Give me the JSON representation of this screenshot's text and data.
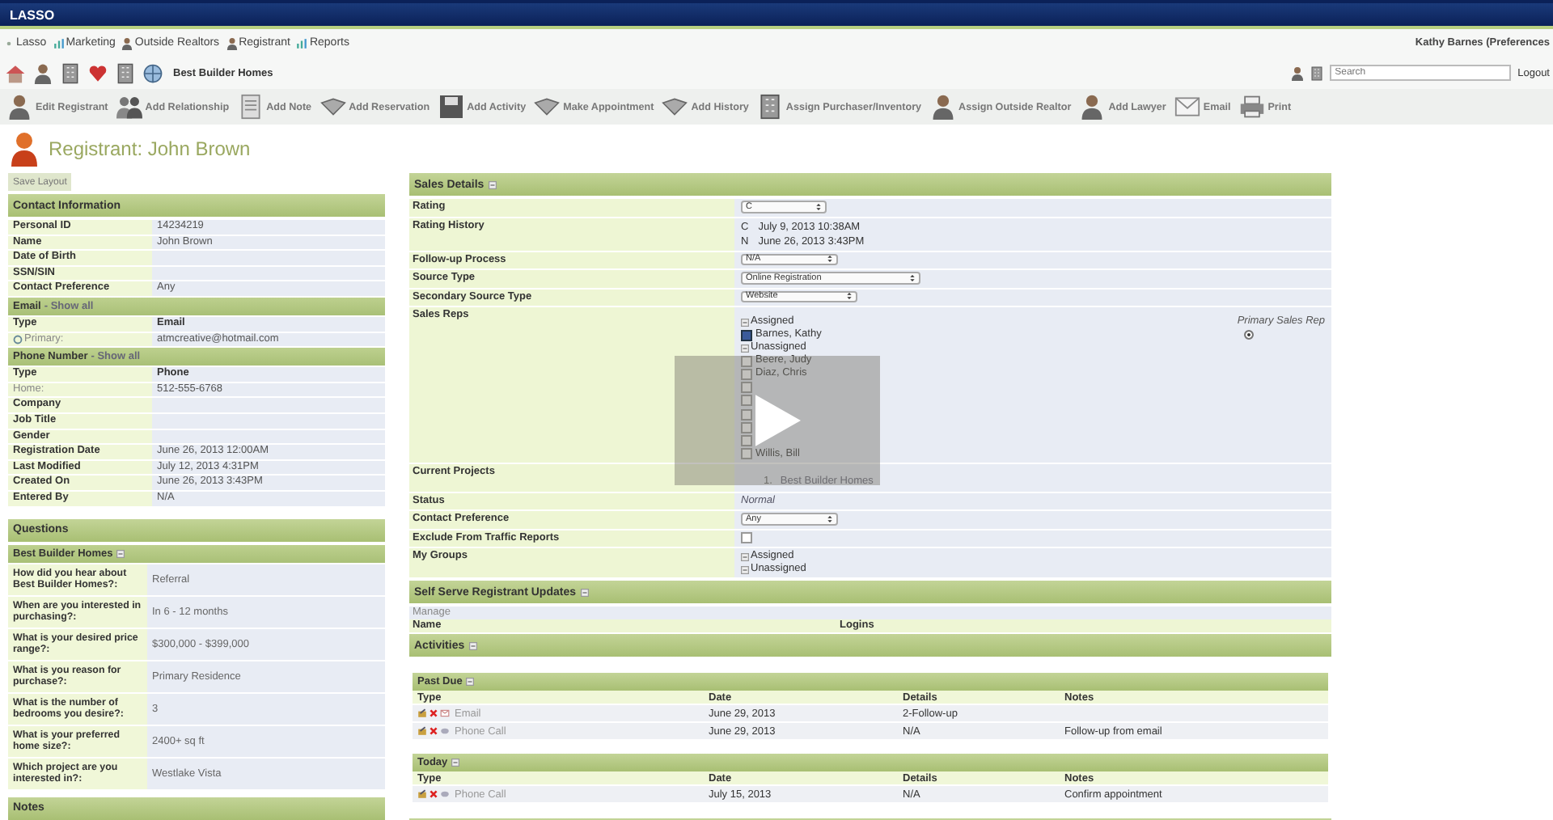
{
  "header": {
    "logo": "LASSO"
  },
  "nav": [
    "Lasso",
    "Marketing",
    "Outside Realtors",
    "Registrant",
    "Reports"
  ],
  "user": "Kathy Barnes (Preferences",
  "company": "Best Builder Homes",
  "search": {
    "placeholder": "Search"
  },
  "logout": "Logout",
  "toolbar": [
    "Edit Registrant",
    "Add Relationship",
    "Add Note",
    "Add Reservation",
    "Add Activity",
    "Make Appointment",
    "Add History",
    "Assign Purchaser/Inventory",
    "Assign Outside Realtor",
    "Add Lawyer",
    "Email",
    "Print"
  ],
  "title": "Registrant: John Brown",
  "save_layout": "Save Layout",
  "contact": {
    "title": "Contact Information",
    "fields": [
      {
        "label": "Personal ID",
        "value": "14234219"
      },
      {
        "label": "Name",
        "value": "John Brown"
      },
      {
        "label": "Date of Birth"
      },
      {
        "label": "SSN/SIN"
      },
      {
        "label": "Contact Preference",
        "value": "Any"
      }
    ],
    "email": {
      "title": "Email",
      "link": "- Show all",
      "columns": [
        "Type",
        "Email"
      ],
      "rows": [
        {
          "type": "Primary:",
          "value": "atmcreative@hotmail.com"
        }
      ]
    },
    "phone": {
      "title": "Phone Number",
      "link": "- Show all",
      "columns": [
        "Type",
        "Phone"
      ],
      "rows": [
        {
          "type": "Home:",
          "value": "512-555-6768"
        }
      ]
    },
    "more_fields": [
      {
        "label": "Company"
      },
      {
        "label": "Job Title"
      },
      {
        "label": "Gender"
      },
      {
        "label": "Registration Date",
        "value": "June 26, 2013 12:00AM"
      },
      {
        "label": "Last Modified",
        "value": "July 12, 2013 4:31PM"
      },
      {
        "label": "Created On",
        "value": "June 26, 2013 3:43PM"
      },
      {
        "label": "Entered By",
        "value": "N/A"
      }
    ]
  },
  "questions": {
    "title": "Questions",
    "subtitle": "Best Builder Homes",
    "items": [
      {
        "q": "How did you hear about Best Builder Homes?:",
        "a": "Referral"
      },
      {
        "q": "When are you interested in purchasing?:",
        "a": "In 6 - 12 months"
      },
      {
        "q": "What is your desired price range?:",
        "a": "$300,000 - $399,000"
      },
      {
        "q": "What is you reason for purchase?:",
        "a": "Primary Residence"
      },
      {
        "q": "What is the number of bedrooms you desire?:",
        "a": "3"
      },
      {
        "q": "What is your preferred home size?:",
        "a": "2400+ sq ft"
      },
      {
        "q": "Which project are you interested in?:",
        "a": "Westlake Vista"
      }
    ]
  },
  "notes": {
    "title": "Notes"
  },
  "sales": {
    "title": "Sales Details",
    "rows": [
      {
        "kind": "select",
        "label": "Rating",
        "value": "C"
      },
      {
        "kind": "history",
        "label": "Rating History",
        "entries": [
          {
            "code": "C",
            "date": "July 9, 2013 10:38AM"
          },
          {
            "code": "N",
            "date": "June 26, 2013 3:43PM"
          }
        ]
      },
      {
        "kind": "select",
        "label": "Follow-up Process",
        "value": "N/A"
      },
      {
        "kind": "select",
        "label": "Source Type",
        "value": "Online Registration"
      },
      {
        "kind": "select",
        "label": "Secondary Source Type",
        "value": "Website"
      },
      {
        "kind": "reps",
        "label": "Sales Reps",
        "assigned_label": "Assigned",
        "primary_label": "Primary Sales Rep",
        "unassigned_label": "Unassigned",
        "assigned": [
          {
            "name": "Barnes, Kathy",
            "checked": true,
            "primary": true
          }
        ],
        "unassigned": [
          {
            "name": "Beere, Judy",
            "checked": false
          },
          {
            "name": "Diaz, Chris",
            "checked": false
          },
          {
            "checked": false
          },
          {
            "checked": false
          },
          {
            "checked": false
          },
          {
            "checked": false
          },
          {
            "checked": false
          },
          {
            "name": "Willis, Bill",
            "checked": false
          }
        ]
      },
      {
        "kind": "projects",
        "label": "Current Projects",
        "items": [
          {
            "number": "1.",
            "name": "Best Builder Homes"
          }
        ]
      },
      {
        "kind": "text",
        "label": "Status",
        "value": "Normal"
      },
      {
        "kind": "select",
        "label": "Contact Preference",
        "value": "Any"
      },
      {
        "kind": "checkbox",
        "label": "Exclude From Traffic Reports",
        "checked": false
      },
      {
        "kind": "groups",
        "label": "My Groups",
        "items": [
          "Assigned",
          "Unassigned"
        ]
      }
    ]
  },
  "self_serve": {
    "title": "Self Serve Registrant Updates",
    "link": "Manage",
    "columns": [
      "Name",
      "Logins"
    ]
  },
  "activities": {
    "title": "Activities",
    "groups": [
      {
        "title": "Past Due",
        "columns": [
          "Type",
          "Date",
          "Details",
          "Notes"
        ],
        "rows": [
          {
            "kind": "email",
            "type": "Email",
            "date": "June 29, 2013",
            "details": "2-Follow-up"
          },
          {
            "kind": "call",
            "type": "Phone Call",
            "date": "June 29, 2013",
            "details": "N/A",
            "notes": "Follow-up from email"
          }
        ]
      },
      {
        "title": "Today",
        "columns": [
          "Type",
          "Date",
          "Details",
          "Notes"
        ],
        "rows": [
          {
            "kind": "call",
            "type": "Phone Call",
            "date": "July 15, 2013",
            "details": "N/A",
            "notes": "Confirm appointment"
          }
        ]
      }
    ]
  }
}
